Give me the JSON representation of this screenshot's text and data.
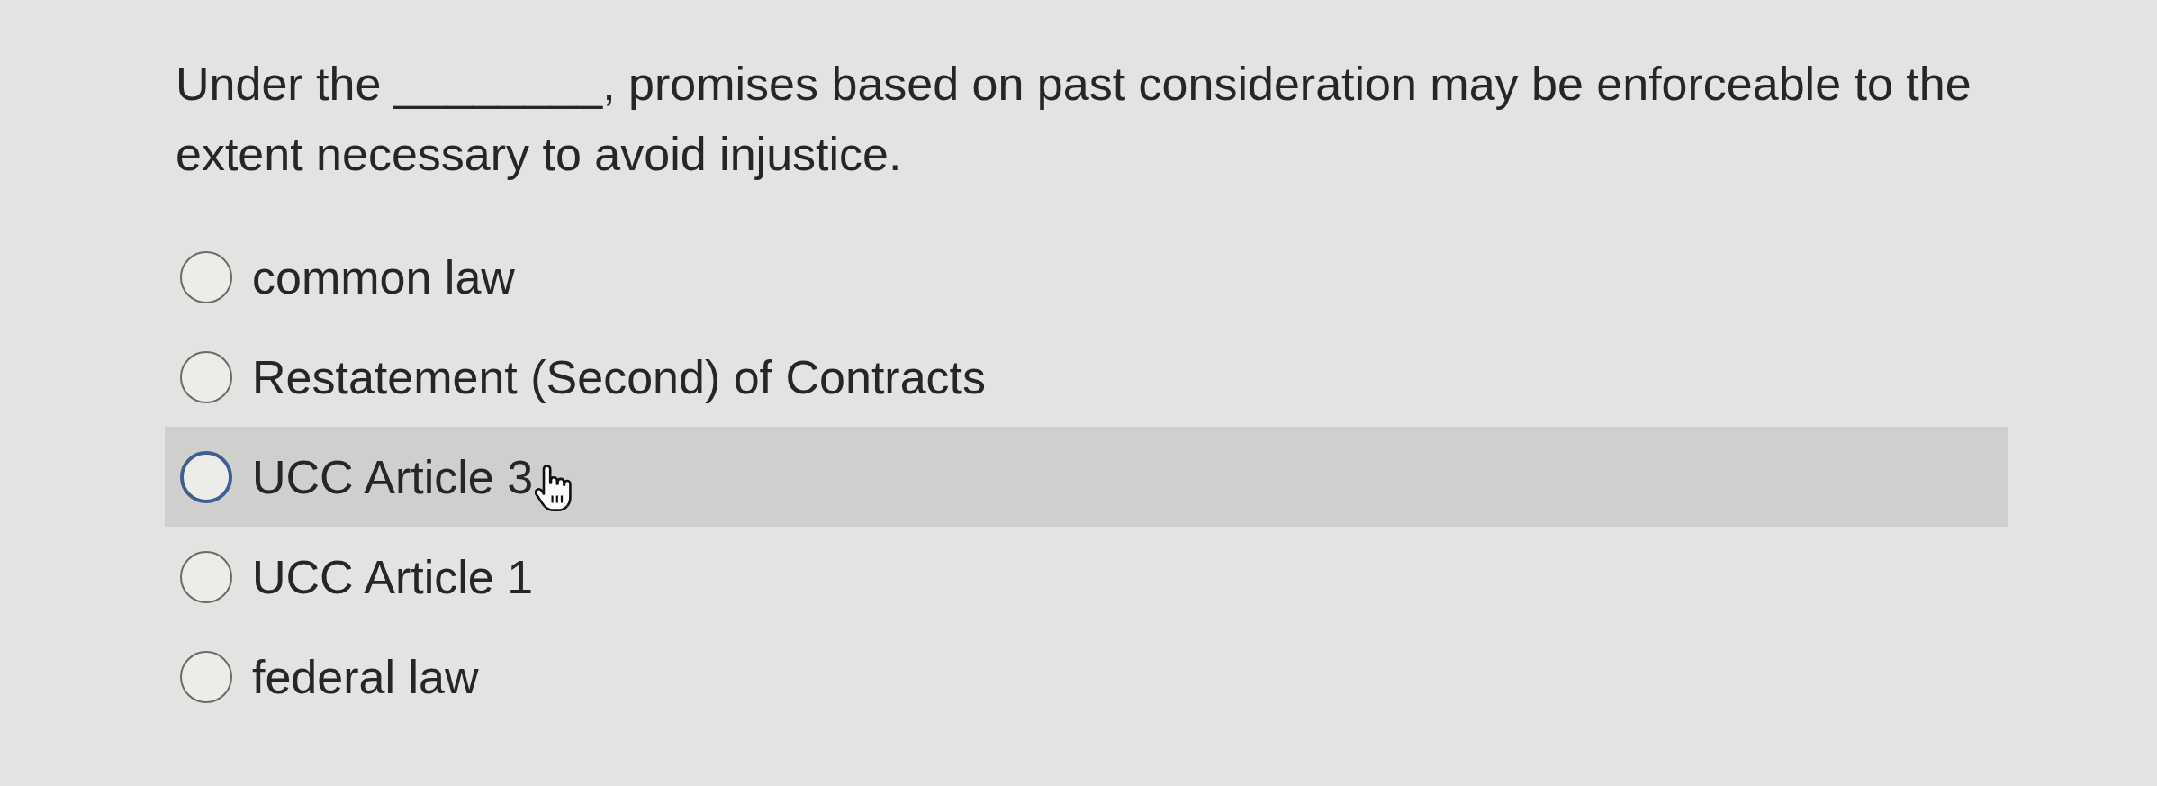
{
  "question": {
    "text": "Under the ________, promises based on past consideration may be enforceable to the extent necessary to avoid injustice."
  },
  "options": [
    {
      "label": "common law",
      "selected": false,
      "hovered": false
    },
    {
      "label": "Restatement (Second) of Contracts",
      "selected": false,
      "hovered": false
    },
    {
      "label": "UCC Article 3",
      "selected": false,
      "hovered": true
    },
    {
      "label": "UCC Article 1",
      "selected": false,
      "hovered": false
    },
    {
      "label": "federal law",
      "selected": false,
      "hovered": false
    }
  ]
}
